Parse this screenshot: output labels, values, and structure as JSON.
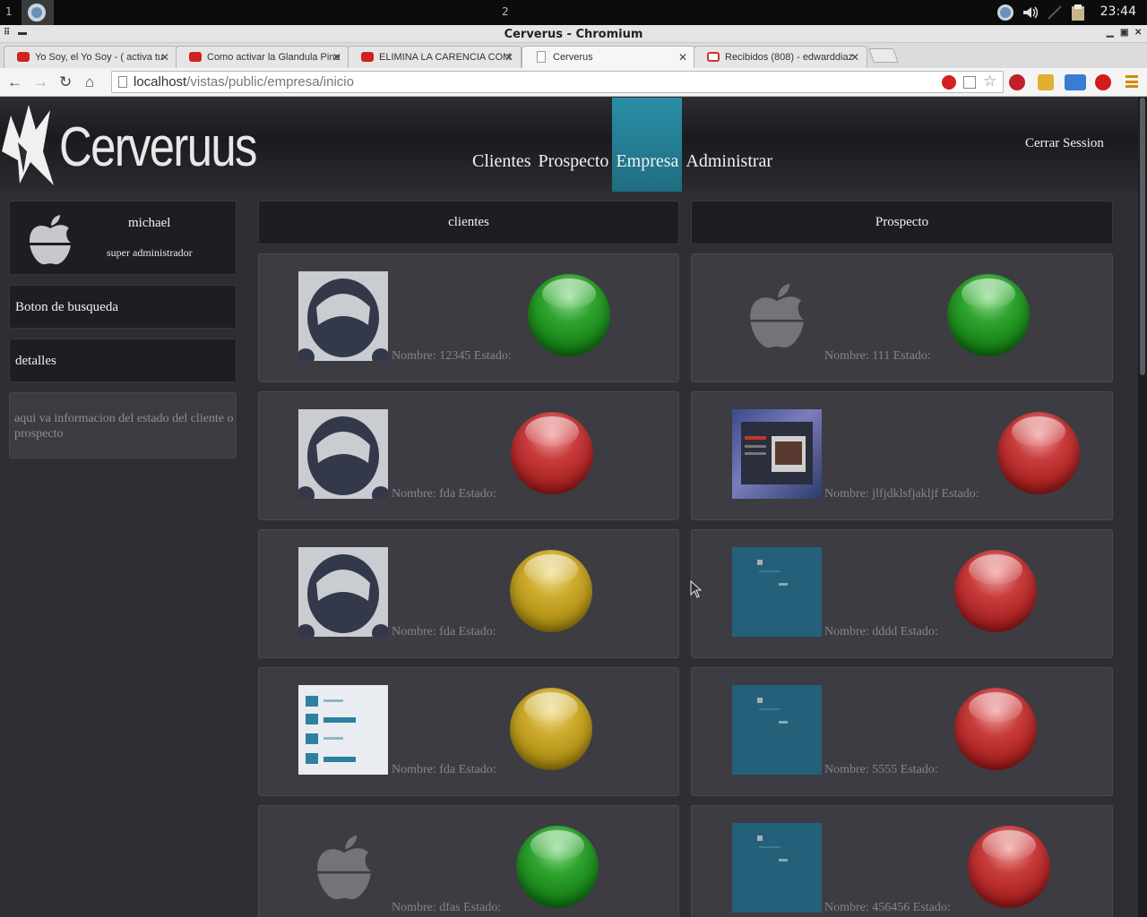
{
  "taskbar": {
    "workspace_1": "1",
    "workspace_2": "2",
    "clock": "23:44"
  },
  "window": {
    "title": "Cerverus - Chromium"
  },
  "tabs": [
    {
      "label": "Yo Soy, el Yo Soy - ( activa tu",
      "icon": "youtube-icon"
    },
    {
      "label": "Como activar la Glandula Pine",
      "icon": "youtube-icon"
    },
    {
      "label": "ELIMINA LA CARENCIA COM",
      "icon": "youtube-icon"
    },
    {
      "label": "Cerverus",
      "icon": "page-icon"
    },
    {
      "label": "Recibidos (808) - edwarddiaz",
      "icon": "gmail-icon"
    }
  ],
  "address": {
    "host": "localhost",
    "path": "/vistas/public/empresa/inicio"
  },
  "site": {
    "logo_text": "Cerveruus",
    "nav": [
      "Clientes",
      "Prospecto",
      "Empresa",
      "Administrar"
    ],
    "active_nav": "Empresa",
    "logout": "Cerrar Session",
    "accent_color": "#2a8ea6"
  },
  "sidebar": {
    "user_name": "michael",
    "user_role": "super administrador",
    "search_button": "Boton de busqueda",
    "details_button": "detalles",
    "info_text": "aqui va informacion del estado del cliente o prospecto"
  },
  "columns": {
    "clients_header": "clientes",
    "prospects_header": "Prospecto"
  },
  "clients": [
    {
      "label": "Nombre: 12345 Estado:",
      "status": "green",
      "thumb": "astronaut"
    },
    {
      "label": "Nombre: fda Estado:",
      "status": "red",
      "thumb": "astronaut"
    },
    {
      "label": "Nombre: fda Estado:",
      "status": "yellow",
      "thumb": "astronaut"
    },
    {
      "label": "Nombre: fda Estado:",
      "status": "yellow",
      "thumb": "libre"
    },
    {
      "label": "Nombre: dfas Estado:",
      "status": "green",
      "thumb": "apple"
    }
  ],
  "prospects": [
    {
      "label": "Nombre: 111 Estado:",
      "status": "green",
      "thumb": "apple"
    },
    {
      "label": "Nombre: jlfjdklsfjakljf Estado:",
      "status": "red",
      "thumb": "screenshot"
    },
    {
      "label": "Nombre: dddd Estado:",
      "status": "red",
      "thumb": "blue"
    },
    {
      "label": "Nombre: 5555 Estado:",
      "status": "red",
      "thumb": "blue"
    },
    {
      "label": "Nombre: 456456 Estado:",
      "status": "red",
      "thumb": "blue"
    }
  ]
}
